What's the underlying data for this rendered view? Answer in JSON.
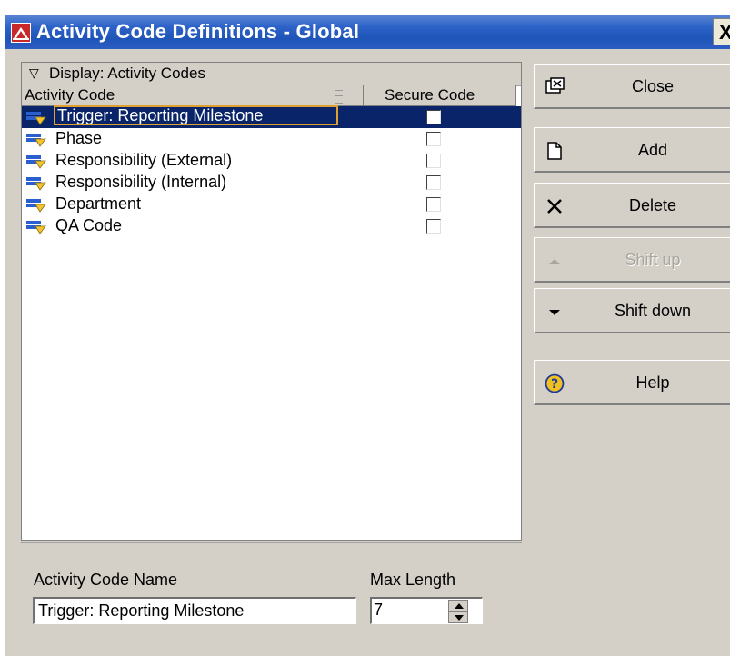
{
  "window": {
    "title": "Activity Code Definitions - Global",
    "close_glyph": "X"
  },
  "list": {
    "display_label": "Display: Activity Codes",
    "columns": [
      "Activity Code",
      "Secure Code"
    ],
    "rows": [
      {
        "name": "Trigger: Reporting Milestone",
        "secure": false,
        "selected": true
      },
      {
        "name": "Phase",
        "secure": false,
        "selected": false
      },
      {
        "name": "Responsibility (External)",
        "secure": false,
        "selected": false
      },
      {
        "name": "Responsibility (Internal)",
        "secure": false,
        "selected": false
      },
      {
        "name": "Department",
        "secure": false,
        "selected": false
      },
      {
        "name": "QA Code",
        "secure": false,
        "selected": false
      }
    ]
  },
  "form": {
    "name_label": "Activity Code Name",
    "name_value": "Trigger: Reporting Milestone",
    "length_label": "Max Length",
    "length_value": "7"
  },
  "buttons": {
    "close": "Close",
    "add": "Add",
    "delete": "Delete",
    "shift_up": "Shift up",
    "shift_down": "Shift down",
    "help": "Help"
  },
  "icons": {
    "app": "app-logo-icon",
    "row": "activity-code-icon",
    "close": "close-window-icon",
    "add": "new-document-icon",
    "delete": "delete-x-icon",
    "shift_up": "triangle-up-icon",
    "shift_down": "triangle-down-icon",
    "help": "help-question-icon"
  },
  "colors": {
    "titlebar": "#2d63c8",
    "selection": "#0a246a",
    "focus_border": "#e0a030",
    "panel": "#d4d0c8"
  }
}
